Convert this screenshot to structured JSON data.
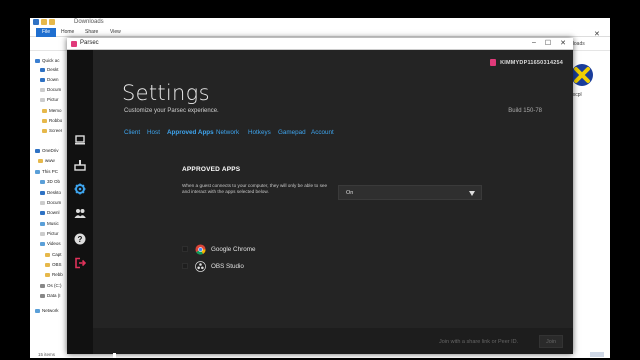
{
  "explorer": {
    "title": "Downloads",
    "ribbon": {
      "file": "File",
      "home": "Home",
      "share": "Share",
      "view": "View"
    },
    "crumb": "Downloads",
    "nav": [
      {
        "label": "Quick ac",
        "color": "#3b7fd1"
      },
      {
        "label": "Deskt",
        "color": "#2f72c4"
      },
      {
        "label": "Down",
        "color": "#2f72c4"
      },
      {
        "label": "Docum",
        "color": "#cccccc"
      },
      {
        "label": "Pictur",
        "color": "#cccccc"
      },
      {
        "label": "Memo",
        "color": "#e6b84a"
      },
      {
        "label": "Robbo",
        "color": "#e6b84a"
      },
      {
        "label": "Screer",
        "color": "#e6b84a"
      },
      {
        "label": "OneDriv",
        "color": "#2f72c4"
      },
      {
        "label": "www",
        "color": "#e6b84a"
      },
      {
        "label": "This PC",
        "color": "#5a9fd8"
      },
      {
        "label": "3D Ob",
        "color": "#5a9fd8"
      },
      {
        "label": "Deskto",
        "color": "#2f72c4"
      },
      {
        "label": "Docum",
        "color": "#cccccc"
      },
      {
        "label": "Downl",
        "color": "#2f72c4"
      },
      {
        "label": "Music",
        "color": "#5a9fd8"
      },
      {
        "label": "Pictur",
        "color": "#cccccc"
      },
      {
        "label": "Videos",
        "color": "#5a9fd8"
      },
      {
        "label": "Capt",
        "color": "#e6b84a"
      },
      {
        "label": "OBS",
        "color": "#e6b84a"
      },
      {
        "label": "Rebb",
        "color": "#e6b84a"
      },
      {
        "label": "Os (C:)",
        "color": "#888888"
      },
      {
        "label": "Data (I",
        "color": "#888888"
      },
      {
        "label": "Network",
        "color": "#5a9fd8"
      }
    ],
    "status": "15 items",
    "desktop_icon_label": "dxcpl"
  },
  "parsec": {
    "window_title": "Parsec",
    "username": "KIMMYDP11650314254",
    "title": "Settings",
    "subtitle": "Customize your Parsec experience.",
    "build": "Build 150-78",
    "tabs": [
      "Client",
      "Host",
      "Approved Apps",
      "Network",
      "Hotkeys",
      "Gamepad",
      "Account"
    ],
    "section_title": "APPROVED APPS",
    "section_desc": "When a guest connects to your computer, they will only be able to see and interact with the apps selected below.",
    "select_value": "On",
    "apps": [
      {
        "name": "Google Chrome"
      },
      {
        "name": "OBS Studio"
      }
    ],
    "footer": {
      "join_placeholder": "Join with a share link or Peer ID.",
      "join_button": "Join"
    },
    "colors": {
      "accent": "#3ea5ef",
      "brand": "#e03a7a",
      "bg": "#242424"
    }
  }
}
